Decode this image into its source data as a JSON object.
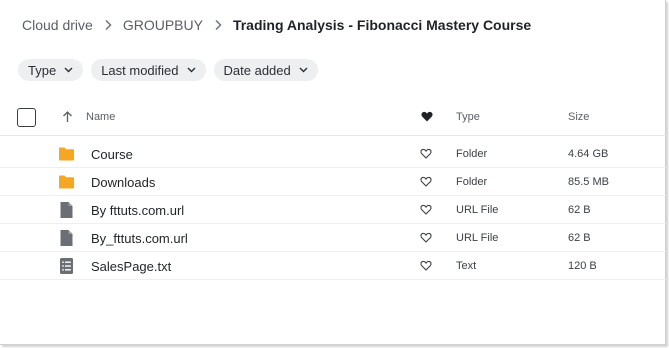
{
  "breadcrumb": {
    "items": [
      "Cloud drive",
      "GROUPBUY"
    ],
    "current": "Trading Analysis - Fibonacci Mastery Course"
  },
  "filters": [
    {
      "label": "Type"
    },
    {
      "label": "Last modified"
    },
    {
      "label": "Date added"
    }
  ],
  "table": {
    "columns": {
      "name": "Name",
      "type": "Type",
      "size": "Size"
    },
    "rows": [
      {
        "name": "Course",
        "type": "Folder",
        "size": "4.64 GB",
        "icon": "folder-icon"
      },
      {
        "name": "Downloads",
        "type": "Folder",
        "size": "85.5 MB",
        "icon": "folder-icon"
      },
      {
        "name": "By fttuts.com.url",
        "type": "URL File",
        "size": "62 B",
        "icon": "file-icon"
      },
      {
        "name": "By_fttuts.com.url",
        "type": "URL File",
        "size": "62 B",
        "icon": "file-icon"
      },
      {
        "name": "SalesPage.txt",
        "type": "Text",
        "size": "120 B",
        "icon": "text-file-icon"
      }
    ]
  },
  "colors": {
    "folder": "#f5a623",
    "file": "#6b6f75",
    "chip_bg": "#eeeff1"
  }
}
